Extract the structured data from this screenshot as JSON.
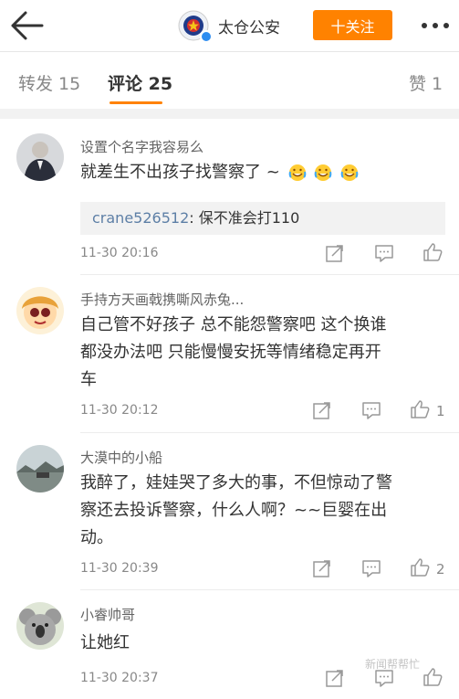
{
  "header": {
    "account_name": "太仓公安",
    "follow_label": "十关注"
  },
  "tabs": [
    {
      "label": "转发 15"
    },
    {
      "label": "评论 25"
    },
    {
      "label": "赞 1"
    }
  ],
  "comments": [
    {
      "username": "设置个名字我容易么",
      "text": "就差生不出孩子找警察了 ~",
      "emojis": [
        "crying-laughing-emoji",
        "crying-laughing-emoji",
        "crying-laughing-emoji"
      ],
      "reply": {
        "name": "crane526512",
        "text": ": 保不准会打110"
      },
      "time": "11-30 20:16",
      "likes": ""
    },
    {
      "username": "手持方天画戟携嘶风赤兔...",
      "text_lines": [
        "自己管不好孩子 总不能怨警察吧 这个换谁",
        "都没办法吧 只能慢慢安抚等情绪稳定再开",
        "车"
      ],
      "time": "11-30 20:12",
      "likes": "1"
    },
    {
      "username": "大漠中的小船",
      "text_lines": [
        "我醉了，娃娃哭了多大的事，不但惊动了警",
        "察还去投诉警察，什么人啊？~~巨婴在出",
        "动。"
      ],
      "time": "11-30 20:39",
      "likes": "2"
    },
    {
      "username": "小睿帅哥",
      "text": "让她红",
      "time": "11-30 20:37",
      "likes": ""
    }
  ],
  "watermark": "新闻帮帮忙",
  "colors": {
    "accent": "#ff8200",
    "link": "#5d7fa6"
  }
}
